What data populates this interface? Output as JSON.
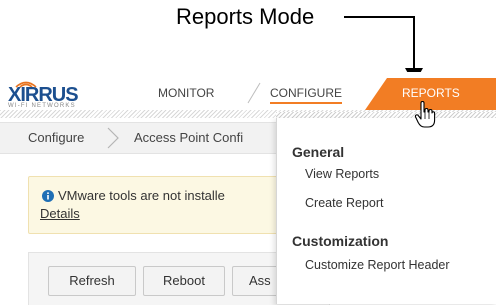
{
  "callout": {
    "label": "Reports Mode"
  },
  "brand": {
    "name": "XIRRUS",
    "tagline": "WI-FI NETWORKS",
    "color": "#1c4f8f"
  },
  "nav": {
    "items": [
      {
        "label": "MONITOR"
      },
      {
        "label": "CONFIGURE"
      },
      {
        "label": "REPORTS",
        "active": true
      }
    ],
    "accent": "#f27d24"
  },
  "breadcrumb": {
    "items": [
      "Configure",
      "Access Point Confi"
    ]
  },
  "alert": {
    "text": "VMware tools are not installe",
    "link": "Details"
  },
  "toolbar": {
    "buttons": [
      "Refresh",
      "Reboot",
      "Ass"
    ]
  },
  "reports_menu": {
    "groups": [
      {
        "title": "General",
        "items": [
          "View Reports",
          "Create Report"
        ]
      },
      {
        "title": "Customization",
        "items": [
          "Customize Report Header"
        ]
      }
    ]
  },
  "icons": [
    "logo-wifi-icon",
    "info-icon",
    "chevron-right-icon",
    "hand-cursor-icon",
    "callout-arrow-icon"
  ]
}
